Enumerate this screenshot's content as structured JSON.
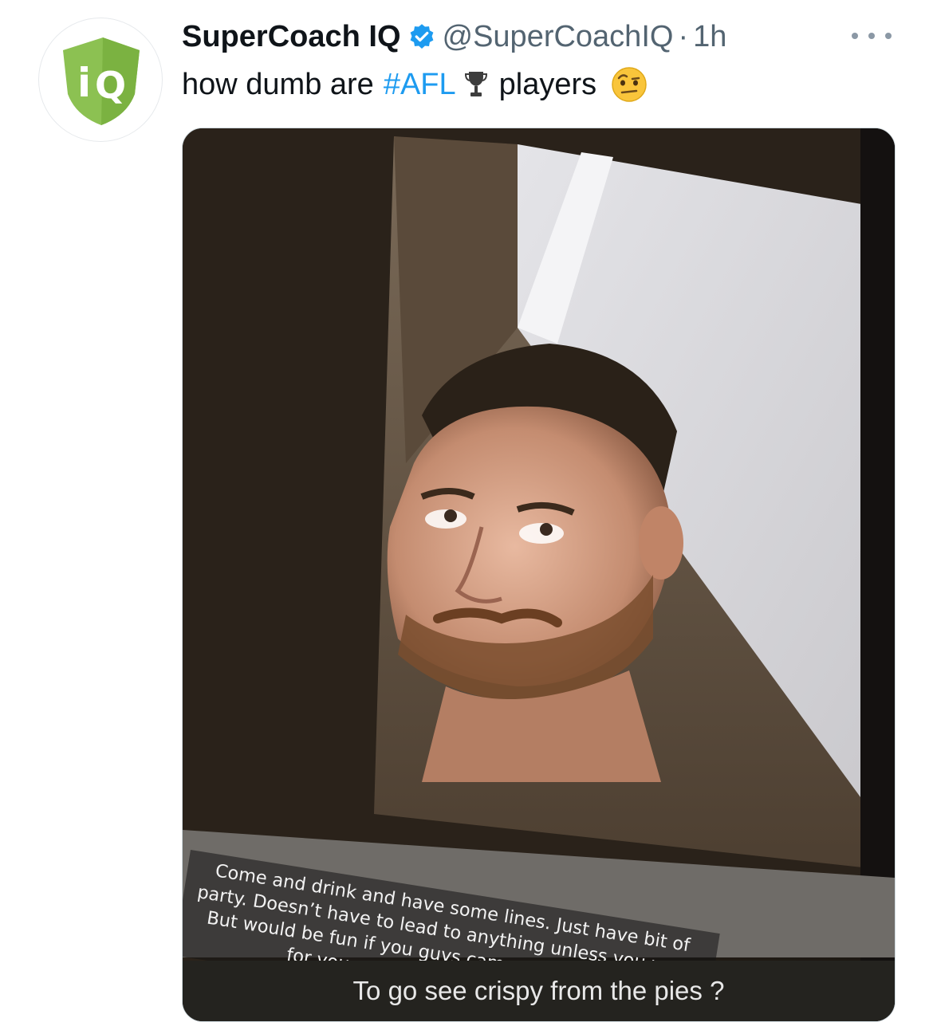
{
  "tweet": {
    "display_name": "SuperCoach IQ",
    "handle": "@SuperCoachIQ",
    "separator": "·",
    "time": "1h",
    "text_before": "how dumb are",
    "hashtag": "#AFL",
    "text_after": "players",
    "hashtag_color": "#1d9bf0",
    "verified_color": "#1d9bf0",
    "icons": {
      "more": "more-options-icon",
      "verified": "verified-badge-icon",
      "trophy": "trophy-emoji",
      "emoji": "raised-eyebrow-emoji"
    }
  },
  "avatar": {
    "logo_text": "iQ",
    "logo_color": "#8cc152"
  },
  "media": {
    "overlay_caption": "Come and drink and have some lines. Just have bit of party. Doesn’t have to lead to anything unless you want. But would be fun if you guys came :) I’m waiting here for you xxxx I’m very respectful xx",
    "bottom_caption": "To go see crispy from the pies ?"
  }
}
